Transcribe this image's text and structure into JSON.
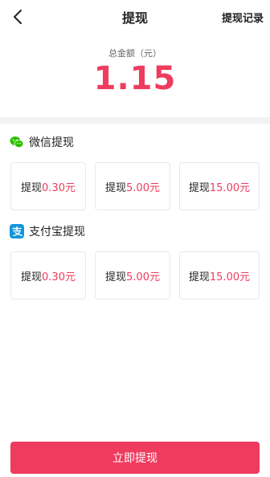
{
  "header": {
    "title": "提现",
    "records_label": "提现记录"
  },
  "balance": {
    "label": "总金额（元）",
    "amount": "1.15",
    "accent_color": "#ee3c5e"
  },
  "wechat": {
    "title": "微信提现",
    "icon": "wechat-icon",
    "options": [
      {
        "prefix": "提现",
        "amount": "0.30元"
      },
      {
        "prefix": "提现",
        "amount": "5.00元"
      },
      {
        "prefix": "提现",
        "amount": "15.00元"
      }
    ]
  },
  "alipay": {
    "title": "支付宝提现",
    "icon": "alipay-icon",
    "options": [
      {
        "prefix": "提现",
        "amount": "0.30元"
      },
      {
        "prefix": "提现",
        "amount": "5.00元"
      },
      {
        "prefix": "提现",
        "amount": "15.00元"
      }
    ]
  },
  "submit": {
    "label": "立即提现",
    "color": "#ef3b5e"
  }
}
